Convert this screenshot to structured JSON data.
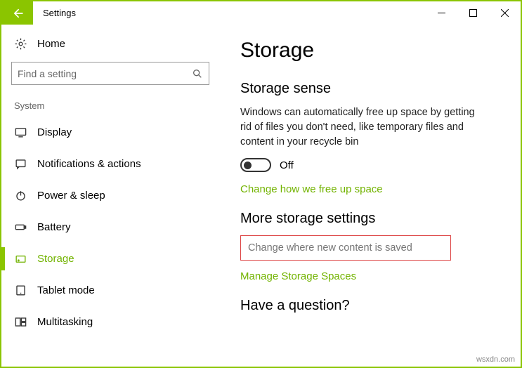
{
  "titlebar": {
    "title": "Settings"
  },
  "sidebar": {
    "home_label": "Home",
    "search_placeholder": "Find a setting",
    "group_label": "System",
    "items": [
      {
        "label": "Display"
      },
      {
        "label": "Notifications & actions"
      },
      {
        "label": "Power & sleep"
      },
      {
        "label": "Battery"
      },
      {
        "label": "Storage"
      },
      {
        "label": "Tablet mode"
      },
      {
        "label": "Multitasking"
      }
    ]
  },
  "main": {
    "page_title": "Storage",
    "sense_heading": "Storage sense",
    "sense_desc": "Windows can automatically free up space by getting rid of files you don't need, like temporary files and content in your recycle bin",
    "toggle_state": "Off",
    "link_change_free": "Change how we free up space",
    "more_heading": "More storage settings",
    "link_change_where": "Change where new content is saved",
    "link_manage_spaces": "Manage Storage Spaces",
    "question_heading": "Have a question?"
  },
  "watermark": "wsxdn.com"
}
